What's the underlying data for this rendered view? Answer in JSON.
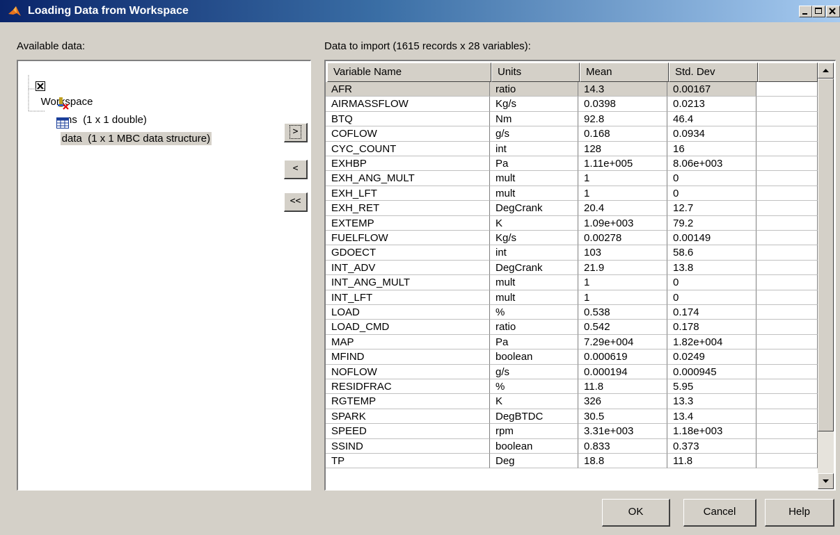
{
  "window": {
    "title": "Loading Data from Workspace"
  },
  "labels": {
    "available": "Available data:",
    "import": "Data to import (1615 records x 28 variables):"
  },
  "tree": {
    "root": "Workspace",
    "items": [
      {
        "label": "ans  (1 x 1 double)",
        "icon": "double-variable-icon"
      },
      {
        "label": "data  (1 x 1 MBC data structure)",
        "icon": "table-icon",
        "selected": true
      }
    ]
  },
  "transfer_buttons": {
    "add": ">",
    "remove": "<",
    "remove_all": "<<"
  },
  "table": {
    "columns": [
      "Variable Name",
      "Units",
      "Mean",
      "Std. Dev"
    ],
    "rows": [
      [
        "AFR",
        "ratio",
        "14.3",
        "0.00167"
      ],
      [
        "AIRMASSFLOW",
        "Kg/s",
        "0.0398",
        "0.0213"
      ],
      [
        "BTQ",
        "Nm",
        "92.8",
        "46.4"
      ],
      [
        "COFLOW",
        "g/s",
        "0.168",
        "0.0934"
      ],
      [
        "CYC_COUNT",
        "int",
        "128",
        "16"
      ],
      [
        "EXHBP",
        "Pa",
        "1.11e+005",
        "8.06e+003"
      ],
      [
        "EXH_ANG_MULT",
        "mult",
        "1",
        "0"
      ],
      [
        "EXH_LFT",
        "mult",
        "1",
        "0"
      ],
      [
        "EXH_RET",
        "DegCrank",
        "20.4",
        "12.7"
      ],
      [
        "EXTEMP",
        "K",
        "1.09e+003",
        "79.2"
      ],
      [
        "FUELFLOW",
        "Kg/s",
        "0.00278",
        "0.00149"
      ],
      [
        "GDOECT",
        "int",
        "103",
        "58.6"
      ],
      [
        "INT_ADV",
        "DegCrank",
        "21.9",
        "13.8"
      ],
      [
        "INT_ANG_MULT",
        "mult",
        "1",
        "0"
      ],
      [
        "INT_LFT",
        "mult",
        "1",
        "0"
      ],
      [
        "LOAD",
        "%",
        "0.538",
        "0.174"
      ],
      [
        "LOAD_CMD",
        "ratio",
        "0.542",
        "0.178"
      ],
      [
        "MAP",
        "Pa",
        "7.29e+004",
        "1.82e+004"
      ],
      [
        "MFIND",
        "boolean",
        "0.000619",
        "0.0249"
      ],
      [
        "NOFLOW",
        "g/s",
        "0.000194",
        "0.000945"
      ],
      [
        "RESIDFRAC",
        "%",
        "11.8",
        "5.95"
      ],
      [
        "RGTEMP",
        "K",
        "326",
        "13.3"
      ],
      [
        "SPARK",
        "DegBTDC",
        "30.5",
        "13.4"
      ],
      [
        "SPEED",
        "rpm",
        "3.31e+003",
        "1.18e+003"
      ],
      [
        "SSIND",
        "boolean",
        "0.833",
        "0.373"
      ],
      [
        "TP",
        "Deg",
        "18.8",
        "11.8"
      ]
    ]
  },
  "buttons": {
    "ok": "OK",
    "cancel": "Cancel",
    "help": "Help"
  },
  "colors": {
    "title_start": "#0a246a",
    "title_end": "#a6caf0",
    "face": "#d4d0c8",
    "selection": "#d4d0c8"
  }
}
